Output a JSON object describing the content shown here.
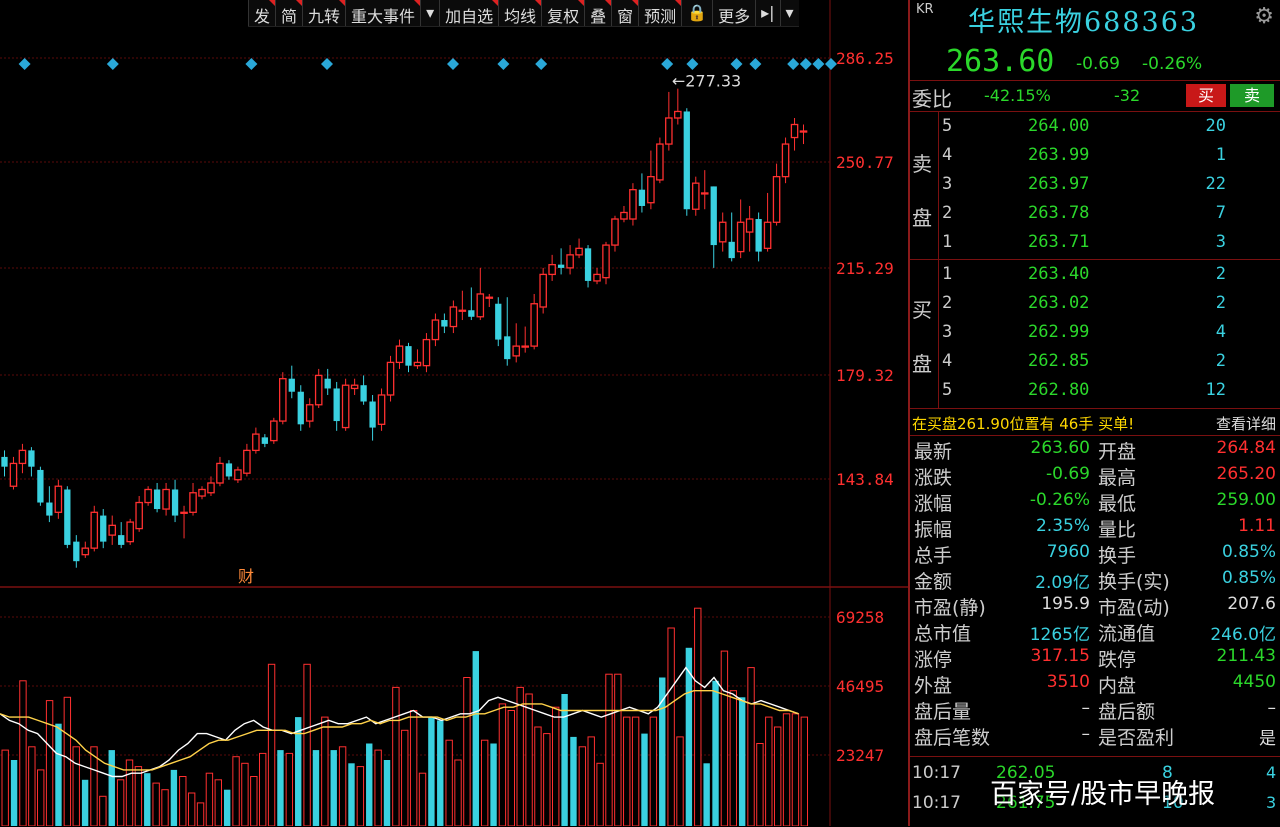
{
  "toolbar": {
    "items": [
      "发",
      "简",
      "九转",
      "重大事件",
      "▾",
      "加自选",
      "均线",
      "复权",
      "叠",
      "窗",
      "预测",
      "🔒",
      "更多",
      "▸|",
      "▾"
    ]
  },
  "chart": {
    "price_axis": [
      "286.25",
      "250.77",
      "215.29",
      "179.32",
      "143.84"
    ],
    "vol_axis": [
      "69258",
      "46495",
      "23247"
    ],
    "high_label": "←277.33",
    "fin_marker": "财",
    "colors": {
      "up": "#ff3030",
      "down": "#3ad1e0",
      "axis_red": "#ff3030",
      "ma1": "#ffffff",
      "ma2": "#ffd24a",
      "grid": "#5a0a0a"
    }
  },
  "chart_data": {
    "type": "candlestick",
    "title": "",
    "ylim": [
      125,
      295
    ],
    "candles": [
      [
        164,
        161,
        166,
        158
      ],
      [
        155,
        162,
        164,
        154
      ],
      [
        162,
        166,
        168,
        159
      ],
      [
        166,
        161,
        167,
        158
      ],
      [
        160,
        150,
        161,
        149
      ],
      [
        150,
        146,
        155,
        144
      ],
      [
        147,
        155,
        157,
        145
      ],
      [
        154,
        137,
        155,
        136
      ],
      [
        138,
        132,
        140,
        130
      ],
      [
        134,
        136,
        138,
        133
      ],
      [
        136,
        147,
        149,
        135
      ],
      [
        146,
        138,
        148,
        136
      ],
      [
        140,
        143,
        146,
        137
      ],
      [
        140,
        137,
        144,
        136
      ],
      [
        138,
        144,
        145,
        137
      ],
      [
        142,
        150,
        152,
        141
      ],
      [
        150,
        154,
        155,
        149
      ],
      [
        154,
        148,
        156,
        147
      ],
      [
        148,
        154,
        156,
        146
      ],
      [
        154,
        146,
        157,
        144
      ],
      [
        147,
        147,
        149,
        139
      ],
      [
        147,
        153,
        156,
        146
      ],
      [
        152,
        154,
        155,
        151
      ],
      [
        153,
        156,
        158,
        152
      ],
      [
        156,
        162,
        164,
        155
      ],
      [
        162,
        158,
        163,
        157
      ],
      [
        157,
        160,
        161,
        156
      ],
      [
        159,
        166,
        168,
        158
      ],
      [
        166,
        171,
        173,
        165
      ],
      [
        170,
        168,
        171,
        167
      ],
      [
        169,
        175,
        176,
        168
      ],
      [
        175,
        188,
        190,
        174
      ],
      [
        188,
        184,
        192,
        182
      ],
      [
        184,
        174,
        186,
        172
      ],
      [
        175,
        180,
        182,
        173
      ],
      [
        180,
        189,
        191,
        179
      ],
      [
        188,
        185,
        191,
        183
      ],
      [
        185,
        175,
        187,
        172
      ],
      [
        173,
        186,
        188,
        172
      ],
      [
        185,
        186,
        188,
        183
      ],
      [
        186,
        181,
        189,
        180
      ],
      [
        181,
        173,
        183,
        169
      ],
      [
        174,
        183,
        185,
        172
      ],
      [
        183,
        193,
        195,
        181
      ],
      [
        193,
        198,
        200,
        191
      ],
      [
        198,
        192,
        199,
        190
      ],
      [
        192,
        193,
        197,
        191
      ],
      [
        192,
        200,
        202,
        190
      ],
      [
        200,
        206,
        208,
        198
      ],
      [
        206,
        204,
        208,
        202
      ],
      [
        204,
        210,
        212,
        202
      ],
      [
        209,
        209,
        215,
        206
      ],
      [
        209,
        207,
        216,
        206
      ],
      [
        207,
        214,
        222,
        206
      ],
      [
        213,
        213,
        214,
        210
      ],
      [
        211,
        200,
        213,
        198
      ],
      [
        201,
        194,
        213,
        192
      ],
      [
        195,
        198,
        205,
        193
      ],
      [
        198,
        198,
        204,
        196
      ],
      [
        198,
        211,
        214,
        197
      ],
      [
        210,
        220,
        222,
        208
      ],
      [
        220,
        223,
        226,
        218
      ],
      [
        223,
        222,
        228,
        220
      ],
      [
        222,
        226,
        229,
        220
      ],
      [
        226,
        228,
        231,
        225
      ],
      [
        228,
        218,
        229,
        216
      ],
      [
        218,
        220,
        222,
        217
      ],
      [
        219,
        229,
        230,
        217
      ],
      [
        229,
        237,
        238,
        227
      ],
      [
        237,
        239,
        241,
        236
      ],
      [
        237,
        246,
        248,
        235
      ],
      [
        246,
        241,
        251,
        239
      ],
      [
        242,
        250,
        258,
        240
      ],
      [
        249,
        260,
        262,
        248
      ],
      [
        260,
        268,
        276,
        258
      ],
      [
        268,
        270,
        277,
        266
      ],
      [
        270,
        240,
        271,
        238
      ],
      [
        240,
        248,
        250,
        238
      ],
      [
        245,
        245,
        252,
        240
      ],
      [
        247,
        229,
        247,
        222
      ],
      [
        230,
        236,
        239,
        227
      ],
      [
        230,
        225,
        239,
        224
      ],
      [
        227,
        236,
        243,
        225
      ],
      [
        233,
        237,
        241,
        227
      ],
      [
        237,
        227,
        239,
        224
      ],
      [
        228,
        236,
        245,
        227
      ],
      [
        236,
        250,
        254,
        235
      ],
      [
        250,
        260,
        262,
        248
      ],
      [
        262,
        266,
        268,
        258
      ],
      [
        264,
        264,
        266,
        260
      ]
    ],
    "volume": [
      23,
      20,
      44,
      24,
      17,
      38,
      31,
      39,
      24,
      14,
      24,
      9,
      23,
      14,
      20,
      18,
      16,
      13,
      11,
      17,
      15,
      10,
      7,
      16,
      14,
      11,
      21,
      19,
      15,
      22,
      49,
      23,
      22,
      33,
      49,
      23,
      33,
      23,
      24,
      19,
      18,
      25,
      23,
      20,
      42,
      29,
      35,
      16,
      33,
      32,
      26,
      20,
      45,
      53,
      26,
      25,
      37,
      35,
      42,
      40,
      30,
      28,
      36,
      40,
      27,
      24,
      27,
      19,
      46,
      46,
      33,
      33,
      28,
      33,
      45,
      60,
      27,
      54,
      66,
      19,
      44,
      53,
      41,
      39,
      48,
      25,
      33,
      30,
      34,
      34,
      33
    ],
    "volume_colors": "ucddddcddcddcdddcducdduudcuuduucdcucucdcucucudduccuducdcuduuuuuccduuuuudcucudcdccducuudddud",
    "ma_vol_1": [
      34,
      32,
      31,
      29,
      28,
      25,
      22,
      21,
      19,
      18,
      17,
      16,
      15,
      15,
      16,
      16,
      17,
      18,
      20,
      23,
      25,
      28,
      28,
      27,
      26,
      29,
      31,
      32,
      30,
      29,
      29,
      28,
      29,
      30,
      31,
      32,
      31,
      31,
      32,
      33,
      31,
      32,
      33,
      34,
      35,
      33,
      33,
      32,
      33,
      34,
      34,
      35,
      38,
      39,
      38,
      37,
      36,
      35,
      34,
      33,
      33,
      34,
      35,
      34,
      33,
      34,
      35,
      36,
      35,
      34,
      36,
      40,
      44,
      48,
      44,
      42,
      45,
      41,
      40,
      38,
      37,
      38,
      37,
      36,
      35,
      34
    ],
    "ma_vol_2": [
      34,
      33,
      33,
      33,
      32,
      31,
      30,
      28,
      26,
      23,
      21,
      19,
      18,
      17,
      17,
      17,
      17,
      18,
      19,
      20,
      21,
      23,
      25,
      26,
      26,
      27,
      28,
      29,
      29,
      29,
      29,
      28,
      28,
      29,
      30,
      30,
      30,
      31,
      31,
      32,
      31,
      32,
      32,
      33,
      33,
      33,
      33,
      32,
      33,
      33,
      34,
      34,
      35,
      36,
      36,
      37,
      37,
      37,
      36,
      35,
      35,
      35,
      35,
      35,
      35,
      35,
      35,
      35,
      35,
      35,
      36,
      38,
      40,
      41,
      41,
      41,
      40,
      39,
      38,
      37,
      37,
      36,
      35,
      35,
      34
    ],
    "events_x": [
      2,
      16,
      38,
      50,
      70,
      78,
      84,
      104,
      108,
      115,
      118,
      124,
      126,
      128,
      130
    ]
  },
  "stock": {
    "kr": "KR",
    "name": "华熙生物",
    "code": "688363",
    "price": "263.60",
    "change": "-0.69",
    "pct": "-0.26%"
  },
  "weibi": {
    "label": "委比",
    "ratio": "-42.15%",
    "diff": "-32",
    "buy": "买",
    "sell": "卖"
  },
  "asks": {
    "side_top": "卖",
    "side_bottom": "盘",
    "rows": [
      {
        "lv": "5",
        "p": "264.00",
        "v": "20"
      },
      {
        "lv": "4",
        "p": "263.99",
        "v": "1"
      },
      {
        "lv": "3",
        "p": "263.97",
        "v": "22"
      },
      {
        "lv": "2",
        "p": "263.78",
        "v": "7"
      },
      {
        "lv": "1",
        "p": "263.71",
        "v": "3"
      }
    ]
  },
  "bids": {
    "side_top": "买",
    "side_bottom": "盘",
    "rows": [
      {
        "lv": "1",
        "p": "263.40",
        "v": "2"
      },
      {
        "lv": "2",
        "p": "263.02",
        "v": "2"
      },
      {
        "lv": "3",
        "p": "262.99",
        "v": "4"
      },
      {
        "lv": "4",
        "p": "262.85",
        "v": "2"
      },
      {
        "lv": "5",
        "p": "262.80",
        "v": "12"
      }
    ]
  },
  "notice": {
    "text": "在买盘261.90位置有 46手 买单!",
    "link": "查看详细"
  },
  "stats": [
    {
      "k": "最新",
      "v": "263.60",
      "c": "#2bd82b",
      "k2": "开盘",
      "v2": "264.84",
      "c2": "#ff3030"
    },
    {
      "k": "涨跌",
      "v": "-0.69",
      "c": "#2bd82b",
      "k2": "最高",
      "v2": "265.20",
      "c2": "#ff3030"
    },
    {
      "k": "涨幅",
      "v": "-0.26%",
      "c": "#2bd82b",
      "k2": "最低",
      "v2": "259.00",
      "c2": "#2bd82b"
    },
    {
      "k": "振幅",
      "v": "2.35%",
      "c": "#3ad1e0",
      "k2": "量比",
      "v2": "1.11",
      "c2": "#ff3030"
    },
    {
      "k": "总手",
      "v": "7960",
      "c": "#3ad1e0",
      "k2": "换手",
      "v2": "0.85%",
      "c2": "#3ad1e0"
    },
    {
      "k": "金额",
      "v": "2.09亿",
      "c": "#3ad1e0",
      "k2": "换手(实)",
      "v2": "0.85%",
      "c2": "#3ad1e0"
    },
    {
      "k": "市盈(静)",
      "v": "195.9",
      "c": "#dddddd",
      "k2": "市盈(动)",
      "v2": "207.6",
      "c2": "#dddddd"
    },
    {
      "k": "总市值",
      "v": "1265亿",
      "c": "#3ad1e0",
      "k2": "流通值",
      "v2": "246.0亿",
      "c2": "#3ad1e0"
    },
    {
      "k": "涨停",
      "v": "317.15",
      "c": "#ff3030",
      "k2": "跌停",
      "v2": "211.43",
      "c2": "#2bd82b"
    },
    {
      "k": "外盘",
      "v": "3510",
      "c": "#ff3030",
      "k2": "内盘",
      "v2": "4450",
      "c2": "#2bd82b"
    },
    {
      "k": "盘后量",
      "v": "–",
      "c": "#dddddd",
      "k2": "盘后额",
      "v2": "–",
      "c2": "#dddddd"
    },
    {
      "k": "盘后笔数",
      "v": "–",
      "c": "#dddddd",
      "k2": "是否盈利",
      "v2": "是",
      "c2": "#dddddd"
    }
  ],
  "ticks": [
    {
      "t": "10:17",
      "p": "262.05",
      "v": "8",
      "c": "4"
    },
    {
      "t": "10:17",
      "p": "261.75",
      "v": "10",
      "c": "3"
    }
  ],
  "watermark": "百家号/股市早晚报"
}
